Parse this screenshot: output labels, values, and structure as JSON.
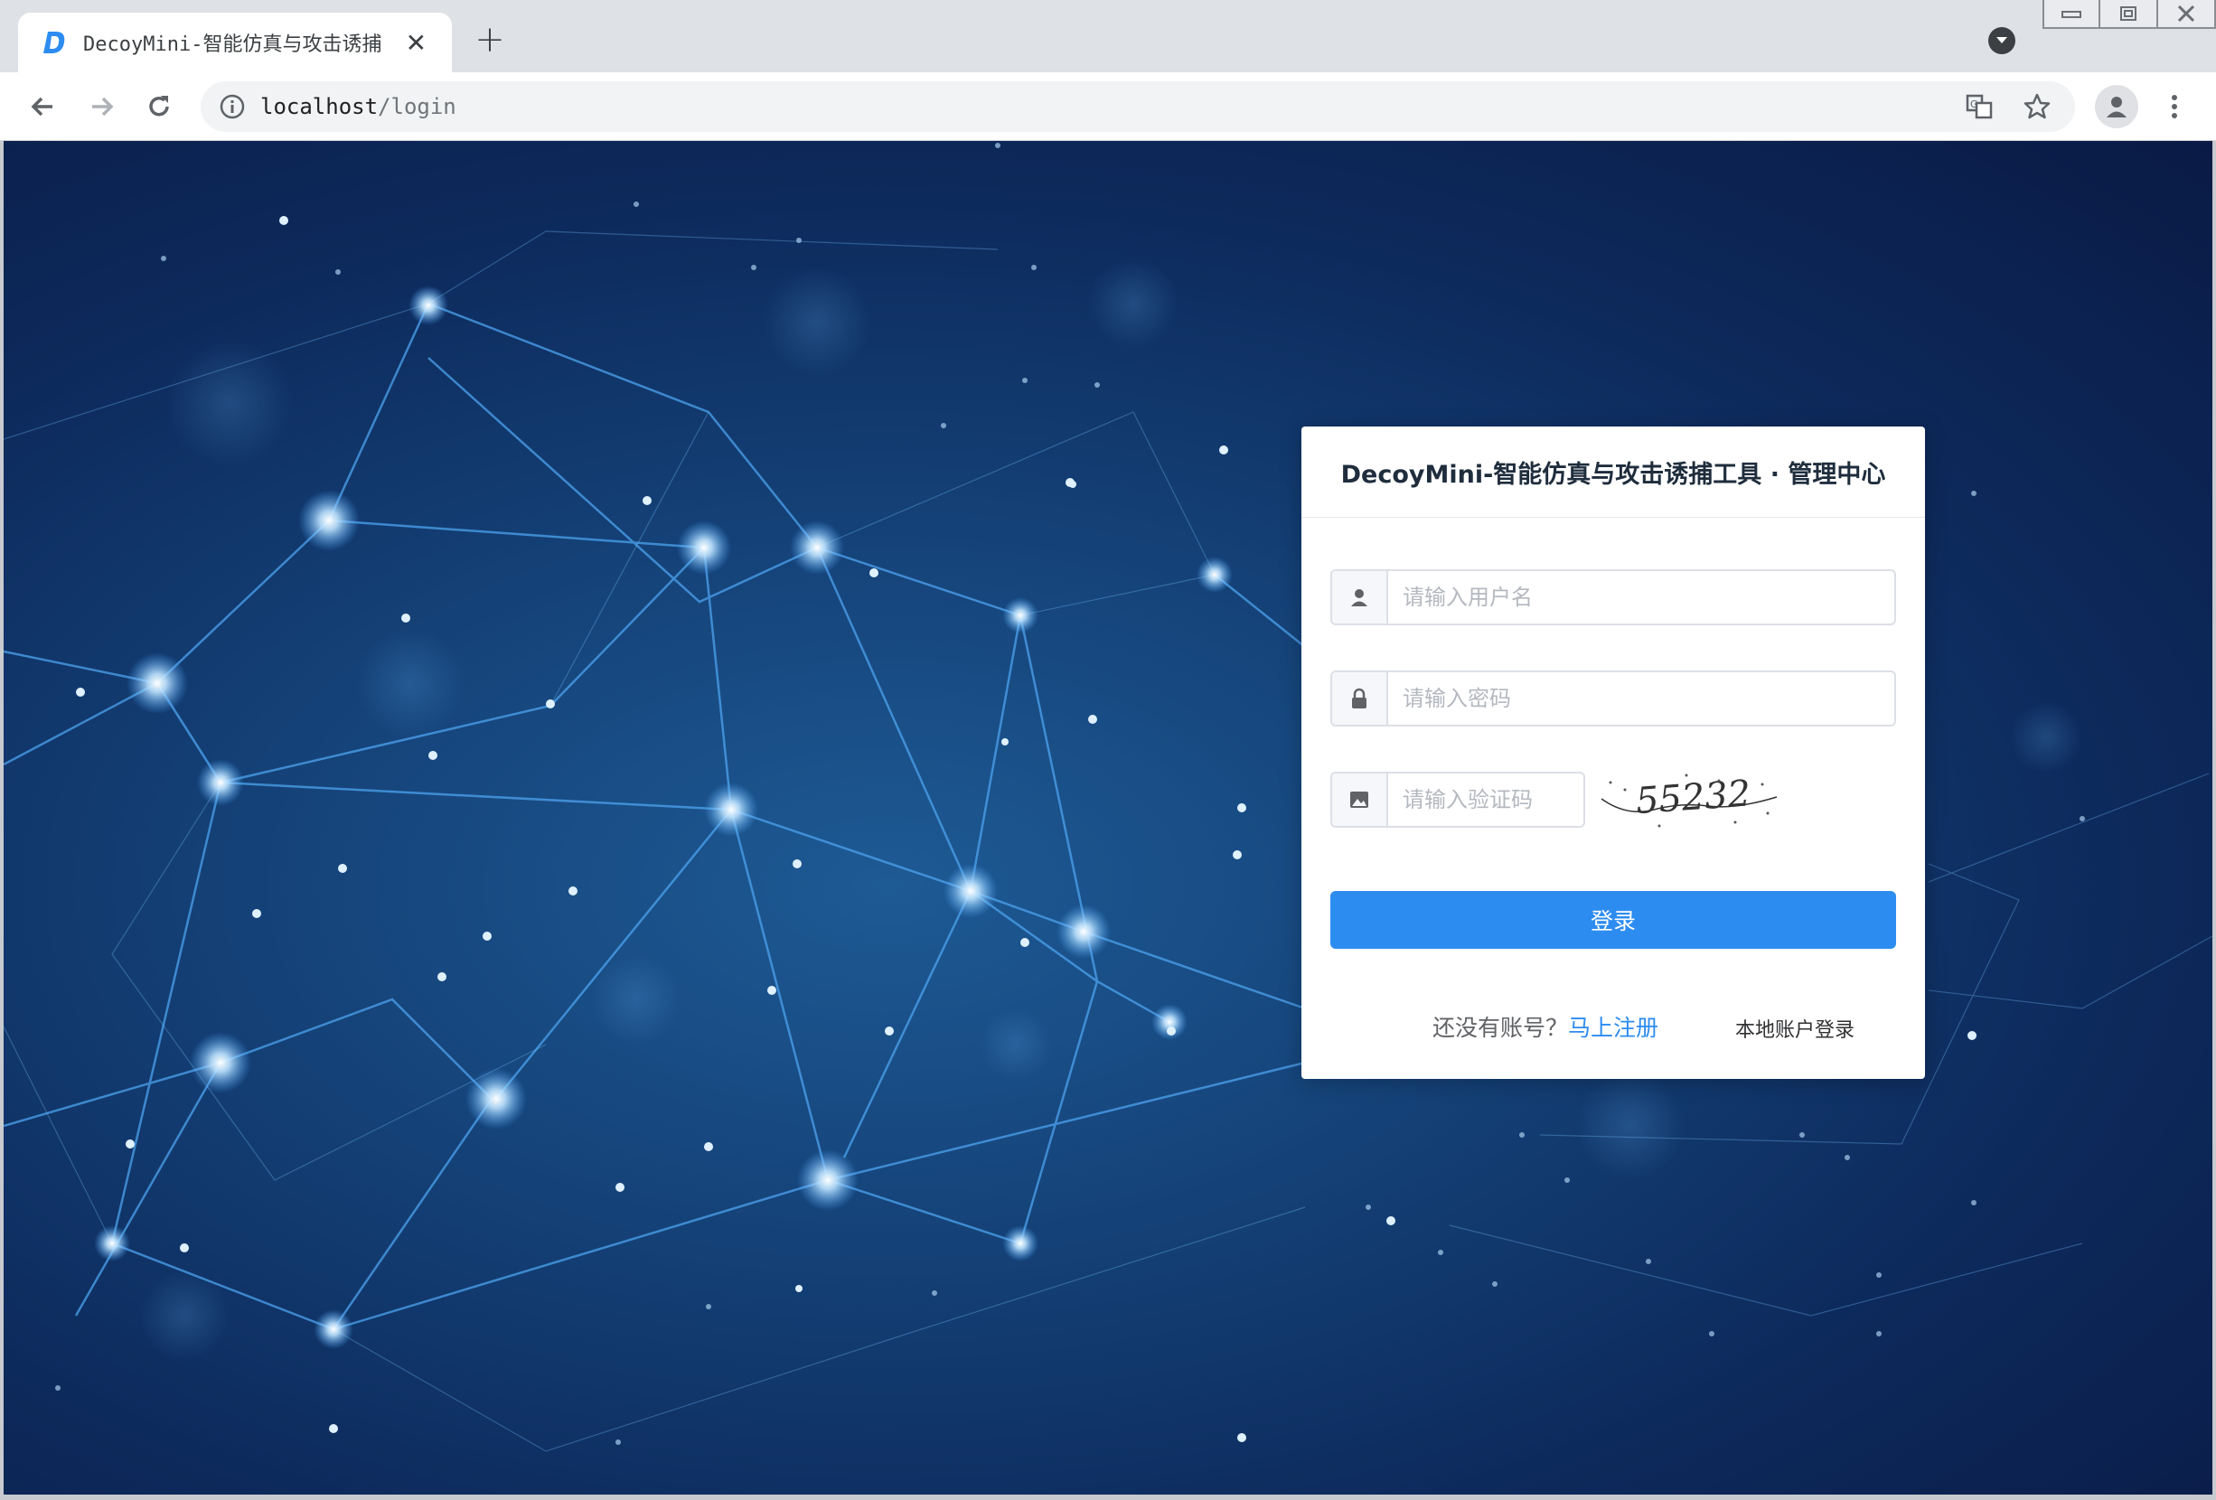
{
  "browser": {
    "tab_title": "DecoyMini-智能仿真与攻击诱捕",
    "url_host": "localhost",
    "url_path": "/login"
  },
  "login": {
    "title": "DecoyMini-智能仿真与攻击诱捕工具 · 管理中心",
    "username_placeholder": "请输入用户名",
    "password_placeholder": "请输入密码",
    "captcha_placeholder": "请输入验证码",
    "captcha_text": "55232",
    "login_button": "登录",
    "no_account_text": "还没有账号？",
    "register_link": "马上注册",
    "local_login": "本地账户登录"
  },
  "colors": {
    "primary": "#2d8cf0",
    "background_dark": "#0a1a45",
    "background_mid": "#1e5a94"
  },
  "icons": {
    "username": "user-icon",
    "password": "lock-icon",
    "captcha": "image-icon"
  }
}
